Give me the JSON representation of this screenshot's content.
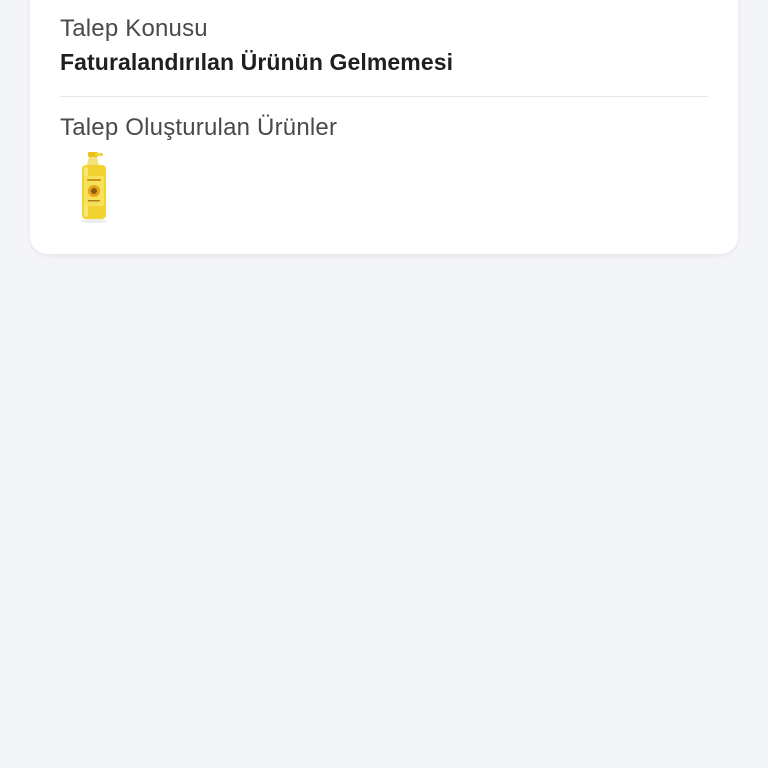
{
  "request": {
    "subject_label": "Talep Konusu",
    "subject_value": "Faturalandırılan Ürünün Gelmemesi",
    "products_label": "Talep Oluşturulan Ürünler"
  },
  "products": [
    {
      "icon": "oil-bottle-icon",
      "bottle_color": "#f2d22e",
      "label_color": "#e8a317"
    }
  ]
}
